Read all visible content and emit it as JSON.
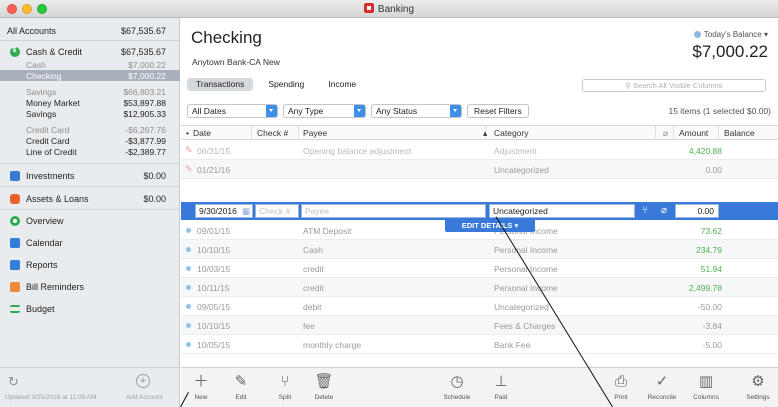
{
  "window": {
    "title": "Banking"
  },
  "sidebar": {
    "all_accounts": {
      "label": "All Accounts",
      "amount": "$67,535.67"
    },
    "cash_credit": {
      "label": "Cash & Credit",
      "amount": "$67,535.67"
    },
    "cash": {
      "label": "Cash",
      "amount": "$7,000.22"
    },
    "checking": {
      "label": "Checking",
      "amount": "$7,000.22"
    },
    "savings": {
      "label": "Savings",
      "amount": "$66,803.21"
    },
    "money_market": {
      "label": "Money Market",
      "amount": "$53,897.88"
    },
    "savings2": {
      "label": "Savings",
      "amount": "$12,905.33"
    },
    "credit_card_group": {
      "label": "Credit Card",
      "amount": "-$6,267.76"
    },
    "credit_card": {
      "label": "Credit Card",
      "amount": "-$3,877.99"
    },
    "line_of_credit": {
      "label": "Line of Credit",
      "amount": "-$2,389.77"
    },
    "investments": {
      "label": "Investments",
      "amount": "$0.00"
    },
    "assets_loans": {
      "label": "Assets & Loans",
      "amount": "$0.00"
    },
    "overview": "Overview",
    "calendar": "Calendar",
    "reports": "Reports",
    "bill_reminders": "Bill Reminders",
    "budget": "Budget",
    "updated": "Updated 3/25/2016 at 11:08 AM",
    "add_account": "Add Account"
  },
  "header": {
    "title": "Checking",
    "bank": "Anytown Bank-CA New",
    "today_label": "Today's Balance ▾",
    "today_amount": "$7,000.22"
  },
  "tabs": [
    "Transactions",
    "Spending",
    "Income"
  ],
  "search": {
    "placeholder": "Search All Visible Columns"
  },
  "filters": {
    "dates": "All Dates",
    "type": "Any Type",
    "status": "Any Status",
    "reset": "Reset Filters",
    "count": "15 items (1 selected $0.00)"
  },
  "columns": {
    "date": "Date",
    "check": "Check #",
    "payee": "Payee",
    "category": "Category",
    "amount": "Amount",
    "balance": "Balance"
  },
  "rows": [
    {
      "date": "06/31/15",
      "payee": "Opening balance adjustment",
      "category": "Adjustment",
      "amount": "4,420.88"
    },
    {
      "date": "01/21/16",
      "payee": "",
      "category": "Uncategorized",
      "amount": "0.00"
    },
    {
      "date": "09/01/15",
      "payee": "ATM Deposit",
      "category": "Personal Income",
      "amount": "73.62"
    },
    {
      "date": "10/10/15",
      "payee": "Cash",
      "category": "Personal Income",
      "amount": "234.79"
    },
    {
      "date": "10/03/15",
      "payee": "credit",
      "category": "Personal Income",
      "amount": "51.94"
    },
    {
      "date": "10/11/15",
      "payee": "credit",
      "category": "Personal Income",
      "amount": "2,499.78"
    },
    {
      "date": "09/05/15",
      "payee": "debit",
      "category": "Uncategorized",
      "amount": "-50.00"
    },
    {
      "date": "10/10/15",
      "payee": "fee",
      "category": "Fees & Charges",
      "amount": "-3.84"
    },
    {
      "date": "10/05/15",
      "payee": "monthly charge",
      "category": "Bank Fee",
      "amount": "-5.00"
    }
  ],
  "edit_row": {
    "date": "9/30/2016",
    "check_placeholder": "Check #",
    "payee_placeholder": "Payee",
    "category": "Uncategorized",
    "amount": "0.00",
    "details": "EDIT DETAILS ▾"
  },
  "toolbar": {
    "new": "New",
    "edit": "Edit",
    "split": "Split",
    "delete": "Delete",
    "schedule": "Schedule",
    "paid": "Paid",
    "print": "Print",
    "reconcile": "Reconcile",
    "columns": "Columns",
    "settings": "Settings"
  }
}
